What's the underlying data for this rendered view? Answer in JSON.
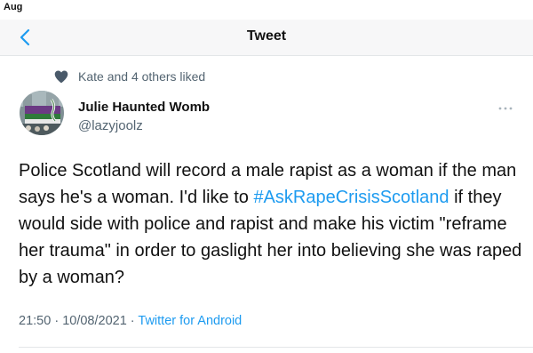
{
  "status_bar": {
    "month": "Aug"
  },
  "nav": {
    "title": "Tweet",
    "back_icon": "chevron-left-icon"
  },
  "social_context": {
    "icon": "heart-icon",
    "text": "Kate and 4 others liked"
  },
  "author": {
    "name": "Julie Haunted Womb",
    "handle": "@lazyjoolz"
  },
  "tweet": {
    "text_before": "Police Scotland will record a male rapist as a woman if the man says he's a woman. I'd like to ",
    "hashtag": "#AskRapeCrisisScotland",
    "text_after": " if they would side with police and rapist and make his victim \"reframe her trauma\" in order to gaslight her into believing she was raped by a woman?"
  },
  "meta": {
    "time": "21:50",
    "separator": " · ",
    "date": "10/08/2021",
    "source": "Twitter for Android"
  },
  "colors": {
    "link": "#1d9bf0",
    "muted": "#536471",
    "heart": "#4a5a6a"
  }
}
